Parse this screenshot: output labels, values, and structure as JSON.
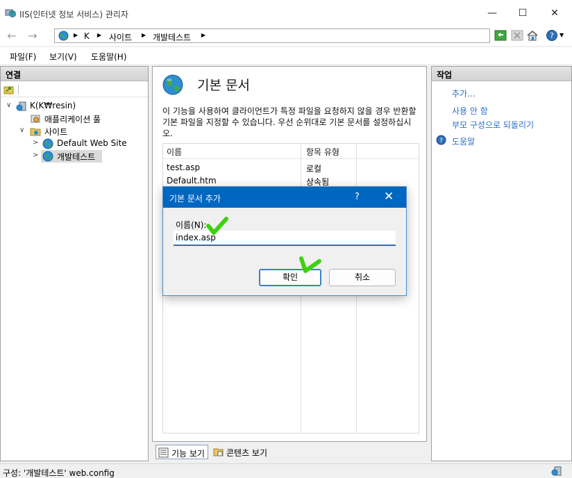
{
  "window": {
    "title": "IIS(인터넷 정보 서비스) 관리자",
    "minimize": "—",
    "maximize": "☐",
    "close": "✕"
  },
  "nav": {
    "back": "←",
    "forward": "→",
    "crumbs": [
      "K",
      "사이트",
      "개발테스트"
    ],
    "separator": "▶"
  },
  "menu": [
    "파일(F)",
    "보기(V)",
    "도움말(H)"
  ],
  "connections": {
    "header": "연결",
    "tree": [
      {
        "label": "K(K₩resin)",
        "toggle": "∨"
      },
      {
        "label": "애플리케이션 풀",
        "toggle": ""
      },
      {
        "label": "사이트",
        "toggle": "∨"
      },
      {
        "label": "Default Web Site",
        "toggle": ">"
      },
      {
        "label": "개발테스트",
        "toggle": ">"
      }
    ]
  },
  "feature": {
    "title": "기본 문서",
    "description": "이 기능을 사용하여 클라이언트가 특정 파일을 요청하지 않을 경우 반환할 기본 파일을 지정할 수 있습니다. 우선 순위대로 기본 문서를 설정하십시오.",
    "columns": [
      "이름",
      "항목 유형"
    ],
    "rows": [
      {
        "name": "test.asp",
        "type": "로컬"
      },
      {
        "name": "Default.htm",
        "type": "상속됨"
      }
    ]
  },
  "bottom_tabs": [
    "기능 보기",
    "콘텐츠 보기"
  ],
  "actions": {
    "header": "작업",
    "items": [
      "추가...",
      "사용 안 함",
      "부모 구성으로 되돌리기",
      "도움말"
    ]
  },
  "status": {
    "text": "구성: '개발테스트' web.config"
  },
  "dialog": {
    "title": "기본 문서 추가",
    "help": "?",
    "close": "✕",
    "name_label": "이름(N):",
    "name_value": "index.asp",
    "ok": "확인",
    "cancel": "취소"
  },
  "colors": {
    "dialog_title_bg": "#0067c0",
    "link": "#2a6fc9",
    "annotation_check": "#3ed10e"
  }
}
